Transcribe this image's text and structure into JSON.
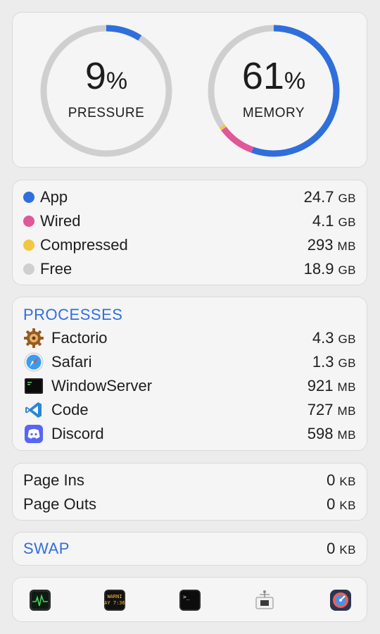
{
  "gauges": {
    "pressure": {
      "value": "9",
      "unit": "%",
      "label": "PRESSURE",
      "fraction": 0.09
    },
    "memory": {
      "value": "61",
      "unit": "%",
      "label": "MEMORY",
      "segments": [
        {
          "name": "App",
          "fraction": 0.555,
          "color": "#2f6fdc"
        },
        {
          "name": "Wired",
          "fraction": 0.092,
          "color": "#e0579a"
        },
        {
          "name": "Compressed",
          "fraction": 0.007,
          "color": "#f3c641"
        }
      ]
    }
  },
  "breakdown": [
    {
      "label": "App",
      "value": "24.7",
      "unit": "GB",
      "color": "#2f6fdc"
    },
    {
      "label": "Wired",
      "value": "4.1",
      "unit": "GB",
      "color": "#e0579a"
    },
    {
      "label": "Compressed",
      "value": "293",
      "unit": "MB",
      "color": "#f3c641"
    },
    {
      "label": "Free",
      "value": "18.9",
      "unit": "GB",
      "color": "#cfcfcf"
    }
  ],
  "processes": {
    "title": "PROCESSES",
    "items": [
      {
        "name": "Factorio",
        "value": "4.3",
        "unit": "GB",
        "icon": "factorio-gear-icon"
      },
      {
        "name": "Safari",
        "value": "1.3",
        "unit": "GB",
        "icon": "safari-compass-icon"
      },
      {
        "name": "WindowServer",
        "value": "921",
        "unit": "MB",
        "icon": "windowserver-terminal-icon"
      },
      {
        "name": "Code",
        "value": "727",
        "unit": "MB",
        "icon": "vscode-icon"
      },
      {
        "name": "Discord",
        "value": "598",
        "unit": "MB",
        "icon": "discord-icon"
      }
    ]
  },
  "paging": [
    {
      "label": "Page Ins",
      "value": "0",
      "unit": "KB"
    },
    {
      "label": "Page Outs",
      "value": "0",
      "unit": "KB"
    }
  ],
  "swap": {
    "label": "SWAP",
    "value": "0",
    "unit": "KB"
  },
  "dock": {
    "icons": [
      {
        "name": "activity-monitor-icon"
      },
      {
        "name": "console-icon",
        "text_line1": "WARNI",
        "text_line2": "AY 7:36"
      },
      {
        "name": "terminal-icon",
        "prompt": ">_"
      },
      {
        "name": "system-information-icon"
      },
      {
        "name": "disk-utility-icon"
      }
    ]
  }
}
